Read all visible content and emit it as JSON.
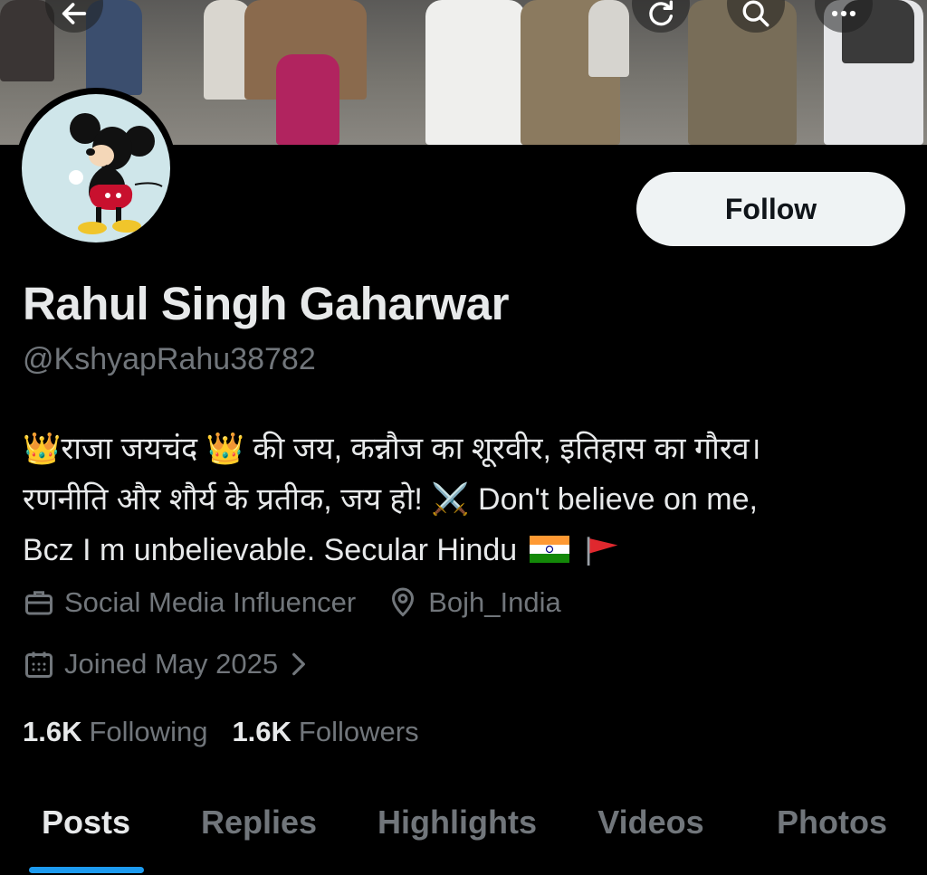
{
  "profile": {
    "name": "Rahul Singh Gaharwar",
    "handle": "@KshyapRahu38782",
    "bio": {
      "line1": "👑राजा जयचंद 👑 की जय, कन्नौज का शूरवीर, इतिहास का गौरव।",
      "line2": "रणनीति और शौर्य के प्रतीक, जय हो! ⚔️ Don't believe on me,",
      "line3_text": "Bcz I m unbelievable. Secular Hindu"
    },
    "occupation": "Social Media Influencer",
    "location": "Bojh_India",
    "joined": "Joined May 2025",
    "following_count": "1.6K",
    "following_label": "Following",
    "followers_count": "1.6K",
    "followers_label": "Followers"
  },
  "actions": {
    "follow_label": "Follow"
  },
  "tabs": [
    {
      "label": "Posts",
      "active": true
    },
    {
      "label": "Replies",
      "active": false
    },
    {
      "label": "Highlights",
      "active": false
    },
    {
      "label": "Videos",
      "active": false
    },
    {
      "label": "Photos",
      "active": false
    }
  ],
  "icons": {
    "header_left": "back-arrow-icon",
    "header_right": [
      "refresh-icon",
      "search-icon",
      "more-icon"
    ],
    "meta": [
      "briefcase-icon",
      "location-pin-icon",
      "calendar-icon",
      "chevron-right-icon"
    ],
    "bio_flags": [
      "india-flag-icon",
      "red-flag-icon"
    ]
  },
  "colors": {
    "background": "#000000",
    "text_primary": "#e7e9ea",
    "text_secondary": "#71767b",
    "accent": "#1d9bf0",
    "follow_button_bg": "#eff3f4"
  }
}
